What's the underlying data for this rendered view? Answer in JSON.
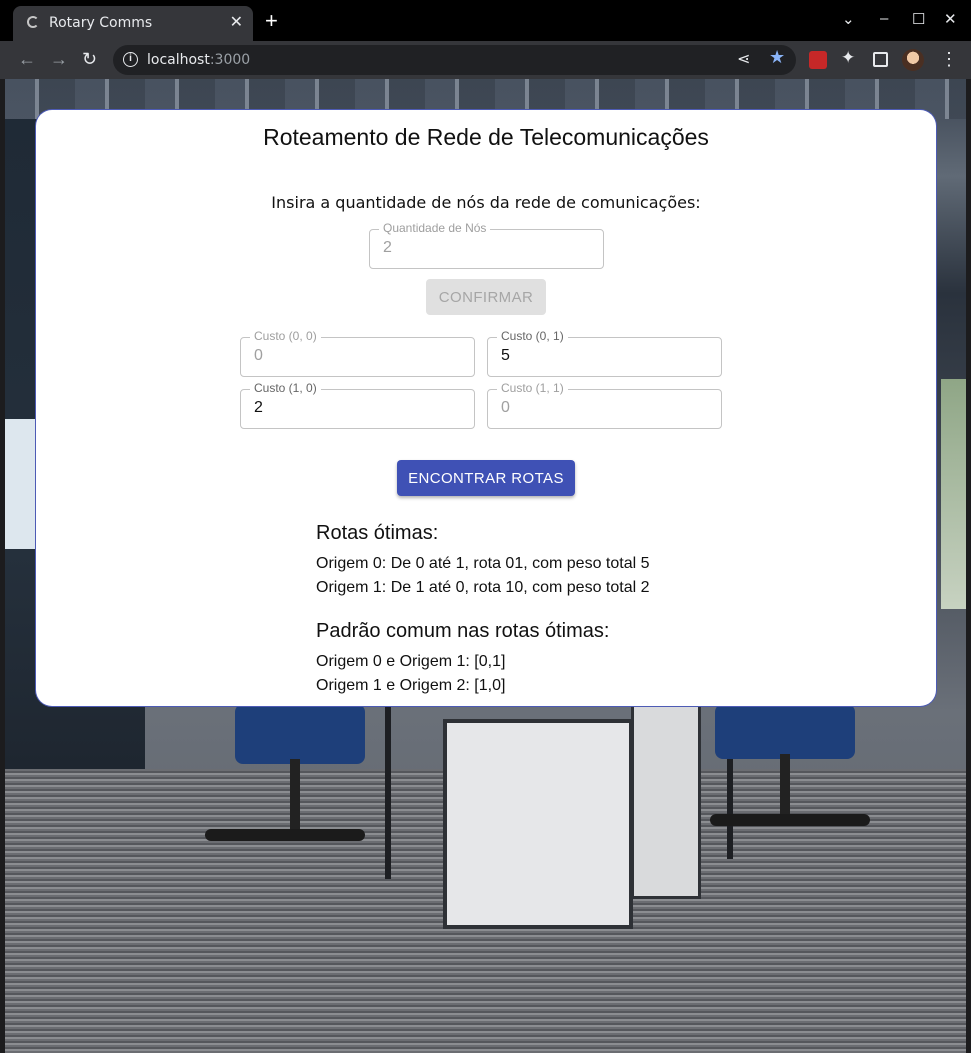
{
  "browser": {
    "tab_title": "Rotary Comms",
    "url_host": "localhost",
    "url_port": ":3000"
  },
  "app": {
    "title": "Roteamento de Rede de Telecomunicações",
    "prompt": "Insira a quantidade de nós da rede de comunicações:",
    "node_count": {
      "label": "Quantidade de Nós",
      "value": "2"
    },
    "confirm_label": "CONFIRMAR",
    "costs": [
      {
        "label": "Custo (0, 0)",
        "value": "0"
      },
      {
        "label": "Custo (0, 1)",
        "value": "5"
      },
      {
        "label": "Custo (1, 0)",
        "value": "2"
      },
      {
        "label": "Custo (1, 1)",
        "value": "0"
      }
    ],
    "find_label": "ENCONTRAR ROTAS",
    "results": {
      "optimal_heading": "Rotas ótimas:",
      "optimal_routes": [
        "Origem 0: De 0 até 1, rota 01, com peso total 5",
        "Origem 1: De 1 até 0, rota 10, com peso total 2"
      ],
      "pattern_heading": "Padrão comum nas rotas ótimas:",
      "patterns": [
        "Origem 0 e Origem 1: [0,1]",
        "Origem 1 e Origem 2: [1,0]"
      ]
    }
  },
  "colors": {
    "primary": "#3f51b5",
    "disabled_button": "#e0e0e0"
  }
}
